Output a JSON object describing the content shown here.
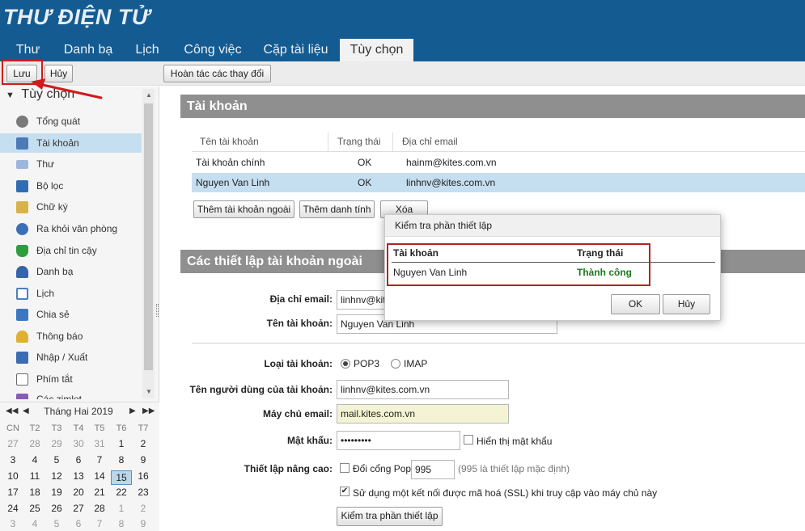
{
  "app": {
    "title": "THƯ ĐIỆN TỬ"
  },
  "tabs": [
    {
      "label": "Thư"
    },
    {
      "label": "Danh bạ"
    },
    {
      "label": "Lịch"
    },
    {
      "label": "Công việc"
    },
    {
      "label": "Cặp tài liệu"
    },
    {
      "label": "Tùy chọn"
    }
  ],
  "toolbar": {
    "save": "Lưu",
    "cancel": "Hủy",
    "undo": "Hoàn tác các thay đổi"
  },
  "sidebar": {
    "title": "Tùy chọn",
    "items": [
      {
        "label": "Tổng quát",
        "icon": "gear-icon",
        "color": "#6b6b6b"
      },
      {
        "label": "Tài khoản",
        "icon": "account-icon",
        "color": "#4a7bb7"
      },
      {
        "label": "Thư",
        "icon": "mail-icon",
        "color": "#6a8fc5"
      },
      {
        "label": "Bộ lọc",
        "icon": "filter-icon",
        "color": "#2e6db4"
      },
      {
        "label": "Chữ ký",
        "icon": "signature-icon",
        "color": "#c49a2c"
      },
      {
        "label": "Ra khỏi văn phòng",
        "icon": "away-icon",
        "color": "#3b6fb6"
      },
      {
        "label": "Địa chỉ tin cậy",
        "icon": "shield-icon",
        "color": "#2e9e3d"
      },
      {
        "label": "Danh bạ",
        "icon": "contact-icon",
        "color": "#3565a8"
      },
      {
        "label": "Lịch",
        "icon": "calendar-icon",
        "color": "#4b7fc0"
      },
      {
        "label": "Chia sẻ",
        "icon": "share-icon",
        "color": "#3b78c0"
      },
      {
        "label": "Thông báo",
        "icon": "bell-icon",
        "color": "#d9a521"
      },
      {
        "label": "Nhập / Xuất",
        "icon": "import-export-icon",
        "color": "#3c6cb3"
      },
      {
        "label": "Phím tắt",
        "icon": "keyboard-icon",
        "color": "#6a6a6a"
      },
      {
        "label": "Các zimlet",
        "icon": "zimlet-icon",
        "color": "#8a5ab5"
      }
    ]
  },
  "calendar": {
    "month": "Tháng Hai 2019",
    "weekdays": [
      "CN",
      "T2",
      "T3",
      "T4",
      "T5",
      "T6",
      "T7"
    ],
    "weeks": [
      [
        "27",
        "28",
        "29",
        "30",
        "31",
        "1",
        "2"
      ],
      [
        "3",
        "4",
        "5",
        "6",
        "7",
        "8",
        "9"
      ],
      [
        "10",
        "11",
        "12",
        "13",
        "14",
        "15",
        "16"
      ],
      [
        "17",
        "18",
        "19",
        "20",
        "21",
        "22",
        "23"
      ],
      [
        "24",
        "25",
        "26",
        "27",
        "28",
        "1",
        "2"
      ],
      [
        "3",
        "4",
        "5",
        "6",
        "7",
        "8",
        "9"
      ]
    ]
  },
  "accounts": {
    "section_title": "Tài khoản",
    "headers": {
      "name": "Tên tài khoản",
      "status": "Trạng thái",
      "email": "Địa chỉ email"
    },
    "rows": [
      {
        "name": "Tài khoản chính",
        "status": "OK",
        "email": "hainm@kites.com.vn"
      },
      {
        "name": "Nguyen Van Linh",
        "status": "OK",
        "email": "linhnv@kites.com.vn"
      }
    ],
    "buttons": {
      "add_external": "Thêm tài khoản ngoài",
      "add_persona": "Thêm danh tính",
      "delete": "Xóa"
    }
  },
  "external": {
    "section_title": "Các thiết lập tài khoản ngoài",
    "email_label": "Địa chỉ email:",
    "email_value": "linhnv@kites.com.vn",
    "account_name_label": "Tên tài khoản:",
    "account_name_value": "Nguyen Van Linh",
    "type_label": "Loại tài khoản:",
    "type_pop3": "POP3",
    "type_imap": "IMAP",
    "username_label": "Tên người dùng của tài khoản:",
    "username_value": "linhnv@kites.com.vn",
    "server_label": "Máy chủ email:",
    "server_value": "mail.kites.com.vn",
    "password_label": "Mật khẩu:",
    "password_value": "•••••••••",
    "show_password": "Hiển thị mật khẩu",
    "advanced_label": "Thiết lập nâng cao:",
    "change_port": "Đổi cổng Pop",
    "port_value": "995",
    "port_hint": "(995 là thiết lập mặc định)",
    "ssl": "Sử dụng một kết nối được mã hoá (SSL) khi truy cập vào máy chủ này",
    "test_button": "Kiểm tra phần thiết lập"
  },
  "dialog": {
    "title": "Kiểm tra phần thiết lập",
    "col_account": "Tài khoản",
    "col_status": "Trạng thái",
    "row_account": "Nguyen Van Linh",
    "row_status": "Thành công",
    "ok": "OK",
    "cancel": "Hủy"
  },
  "colors": {
    "header": "#145b92",
    "success": "#1d7a1d",
    "annotation": "#d11a1a"
  }
}
